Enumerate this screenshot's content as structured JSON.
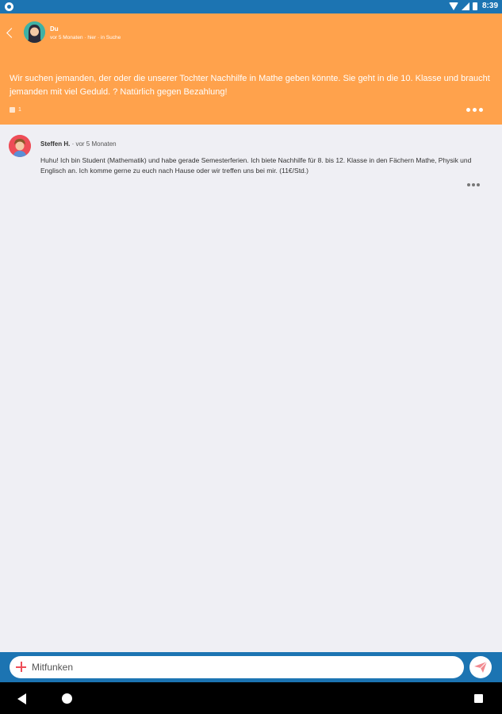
{
  "status_bar": {
    "time": "8:39"
  },
  "post": {
    "author": "Du",
    "meta": "vor 5 Monaten · hier · in Suche",
    "text": "Wir suchen jemanden, der oder die unserer Tochter Nachhilfe in Mathe geben könnte. Sie geht in die 10. Klasse und braucht jemanden mit viel Geduld. ? Natürlich gegen Bezahlung!",
    "likes": "1"
  },
  "comment": {
    "author": "Steffen H.",
    "time": "· vor 5 Monaten",
    "text": "Huhu! Ich bin Student (Mathematik) und habe gerade Semesterferien. Ich biete Nachhilfe für 8. bis 12. Klasse in den Fächern Mathe, Physik und Englisch an. Ich komme gerne zu euch nach Hause oder wir treffen uns bei mir. (11€/Std.)"
  },
  "composer": {
    "placeholder": "Mitfunken"
  },
  "colors": {
    "status_bar": "#1c74b2",
    "post_header": "#ffa24c",
    "background": "#efeff4",
    "accent": "#ee4d57"
  },
  "icons": {
    "back": "chevron-left-icon",
    "like": "thumbs-up-icon",
    "more": "more-dots-icon",
    "plus": "plus-icon",
    "send": "paper-plane-icon"
  }
}
